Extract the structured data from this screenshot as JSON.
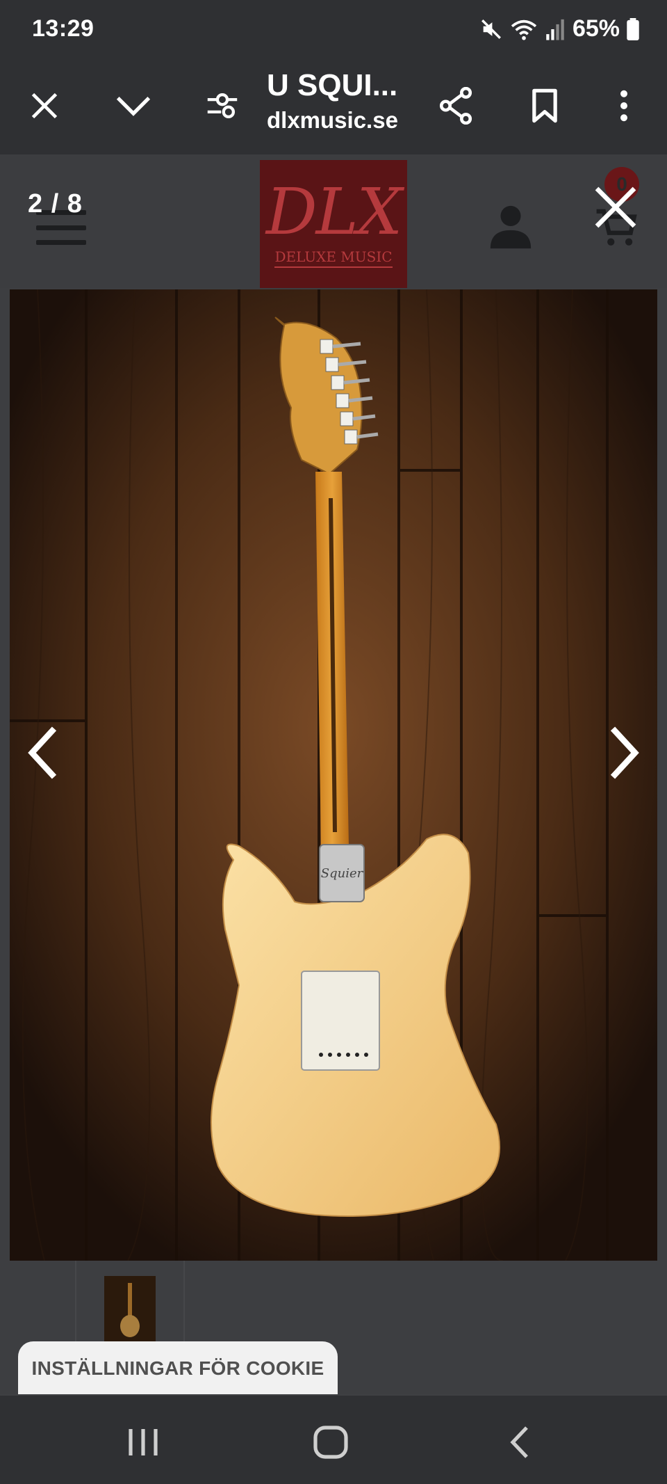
{
  "status_bar": {
    "time": "13:29",
    "battery": "65%",
    "icons": [
      "mute-icon",
      "wifi-icon",
      "signal-icon",
      "battery-icon"
    ]
  },
  "browser": {
    "title": "U SQUI...",
    "domain": "dlxmusic.se",
    "icons": [
      "close-icon",
      "chevron-down-icon",
      "tune-icon",
      "share-icon",
      "bookmark-icon",
      "more-vert-icon"
    ]
  },
  "site": {
    "logo_text": "DLX",
    "logo_subtext": "DELUXE MUSIC",
    "cart_count": "0"
  },
  "viewer": {
    "counter": "2 / 8",
    "image_alt": "Squier guitar back view"
  },
  "cookie": {
    "label": "INSTÄLLNINGAR FÖR COOKIE"
  },
  "colors": {
    "bar_bg": "#2f3033",
    "page_bg": "#3d3e41",
    "logo_bg": "#5a1416",
    "logo_fg": "#b53a3d",
    "guitar_body": "#f6d08a"
  }
}
